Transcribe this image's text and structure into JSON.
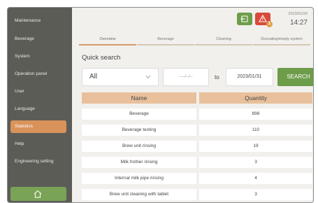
{
  "sidebar": {
    "items": [
      {
        "label": "Maintenance"
      },
      {
        "label": "Beverage"
      },
      {
        "label": "System"
      },
      {
        "label": "Operation panel"
      },
      {
        "label": "User"
      },
      {
        "label": "Language"
      },
      {
        "label": "Statistics"
      },
      {
        "label": "Help"
      },
      {
        "label": "Engineering setting"
      }
    ],
    "active_index": 6,
    "home_icon": "home-icon"
  },
  "header": {
    "date": "2023/01/20",
    "time": "14:27",
    "alert_badge": "1",
    "colors": {
      "green": "#6e9d4a",
      "red": "#d94a3c",
      "accent": "#d9935a"
    }
  },
  "tabs": [
    {
      "label": "Overview"
    },
    {
      "label": "Beverage"
    },
    {
      "label": "Cleaning"
    },
    {
      "label": "Descaling/empty system"
    }
  ],
  "search": {
    "label": "Quick search",
    "filter_value": "All",
    "date_from_placeholder": "----/--/--",
    "to_label": "to",
    "date_to_value": "2023/01/31",
    "button_label": "SEARCH"
  },
  "table": {
    "headers": {
      "name": "Name",
      "quantity": "Quantity"
    },
    "rows": [
      {
        "name": "Beverage",
        "quantity": "898"
      },
      {
        "name": "Beverage testing",
        "quantity": "110"
      },
      {
        "name": "Brew unit rinsing",
        "quantity": "19"
      },
      {
        "name": "Milk frother rinsing",
        "quantity": "3"
      },
      {
        "name": "Internal milk pipe rinsing",
        "quantity": "4"
      },
      {
        "name": "Brew unit cleaning with tablet",
        "quantity": "3"
      }
    ]
  }
}
